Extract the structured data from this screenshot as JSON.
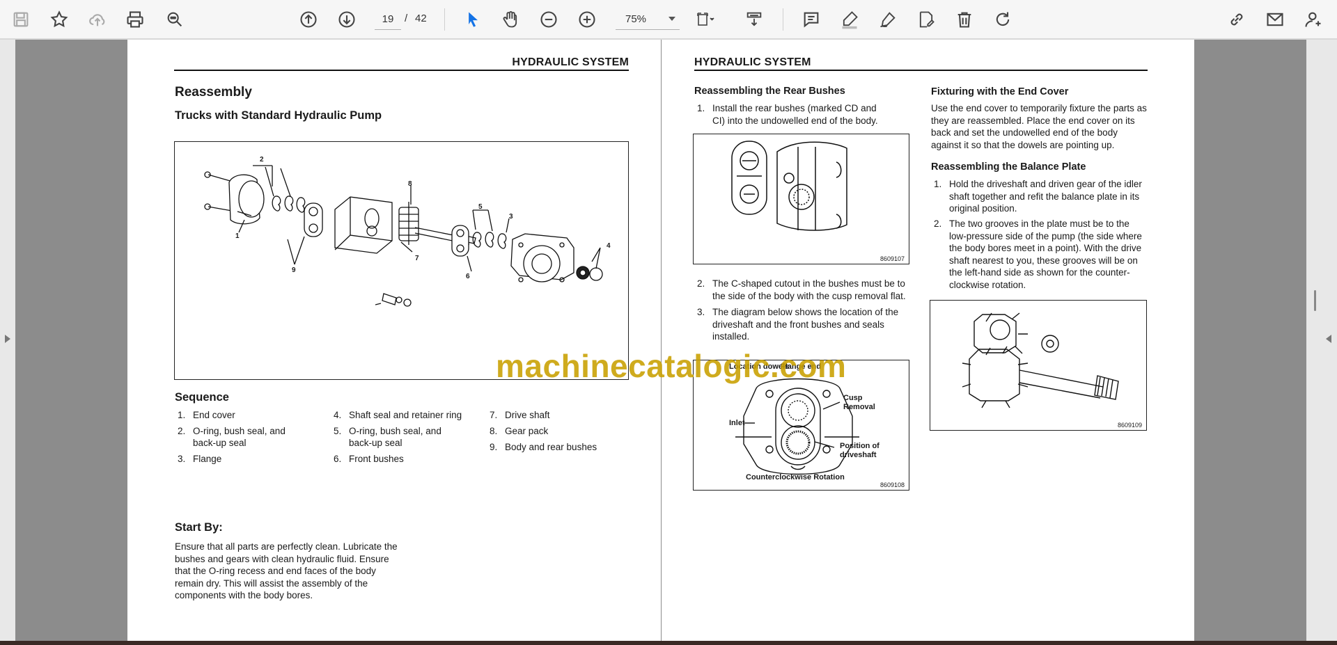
{
  "toolbar": {
    "icons": [
      "save-icon",
      "bookmark-star-icon",
      "upload-cloud-icon",
      "print-icon",
      "find-icon",
      "page-up-icon",
      "page-down-icon",
      "select-cursor-icon",
      "hand-tool-icon",
      "zoom-out-icon",
      "zoom-in-icon",
      "fit-page-icon",
      "scroll-mode-icon",
      "comment-icon",
      "highlight-icon",
      "draw-icon",
      "fill-sign-icon",
      "delete-icon",
      "rotate-icon",
      "share-link-icon",
      "email-icon",
      "account-icon"
    ],
    "page_current": "19",
    "page_separator": "/",
    "page_total": "42",
    "zoom": "75%",
    "accent": "#1473e6"
  },
  "left_page": {
    "header": "HYDRAULIC SYSTEM",
    "title": "Reassembly",
    "subtitle": "Trucks with Standard Hydraulic Pump",
    "figure_callouts": [
      "2",
      "8",
      "5",
      "3",
      "4",
      "1",
      "9",
      "7",
      "6"
    ],
    "sequence_heading": "Sequence",
    "sequence": [
      {
        "num": "1.",
        "text": "End cover"
      },
      {
        "num": "2.",
        "text": "O-ring, bush seal, and back-up seal"
      },
      {
        "num": "3.",
        "text": "Flange"
      },
      {
        "num": "4.",
        "text": "Shaft seal and retainer ring"
      },
      {
        "num": "5.",
        "text": "O-ring, bush seal, and back-up seal"
      },
      {
        "num": "6.",
        "text": "Front bushes"
      },
      {
        "num": "7.",
        "text": "Drive shaft"
      },
      {
        "num": "8.",
        "text": "Gear pack"
      },
      {
        "num": "9.",
        "text": "Body and rear bushes"
      }
    ],
    "start_heading": "Start By:",
    "start_text": "Ensure that all parts are perfectly clean. Lubricate the bushes and gears with clean hydraulic fluid. Ensure that the O-ring recess and end faces of the body remain dry. This will assist the assembly of the components with the body bores."
  },
  "right_page": {
    "header": "HYDRAULIC SYSTEM",
    "rear_heading": "Reassembling the Rear Bushes",
    "rear_steps": [
      {
        "num": "1.",
        "text": "Install the rear bushes (marked CD and CI) into the undowelled end of the body."
      },
      {
        "num": "2.",
        "text": "The C-shaped cutout in the bushes must be to the side of the body with the cusp removal flat."
      },
      {
        "num": "3.",
        "text": "The diagram below shows the location of the driveshaft and the front bushes and seals installed."
      }
    ],
    "fig1_code": "8609107",
    "fig2_code": "8609108",
    "fig2_labels": {
      "location_dowels": "Location dowels",
      "flange_end": "Flange end",
      "cusp_removal": "Cusp Removal",
      "inlet": "Inlet",
      "driveshaft_pos": "Position of driveshaft",
      "rotation": "Counterclockwise Rotation"
    },
    "fixturing_heading": "Fixturing with the End Cover",
    "fixturing_text": "Use the end cover to temporarily fixture the parts as they are reassembled. Place the end cover on its back and set the undowelled end of the body against it so that the dowels are pointing up.",
    "balance_heading": "Reassembling the Balance Plate",
    "balance_steps": [
      {
        "num": "1.",
        "text": "Hold the driveshaft and driven gear of the idler shaft together and refit the balance plate in its original position."
      },
      {
        "num": "2.",
        "text": "The two grooves in the plate must be to the low-pressure side of the pump (the side where the body bores meet in a point). With the drive shaft nearest to you, these grooves will be on the left-hand side as shown for the counter-clockwise rotation."
      }
    ],
    "fig3_code": "8609109"
  },
  "watermark": "machinecatalogic.com"
}
